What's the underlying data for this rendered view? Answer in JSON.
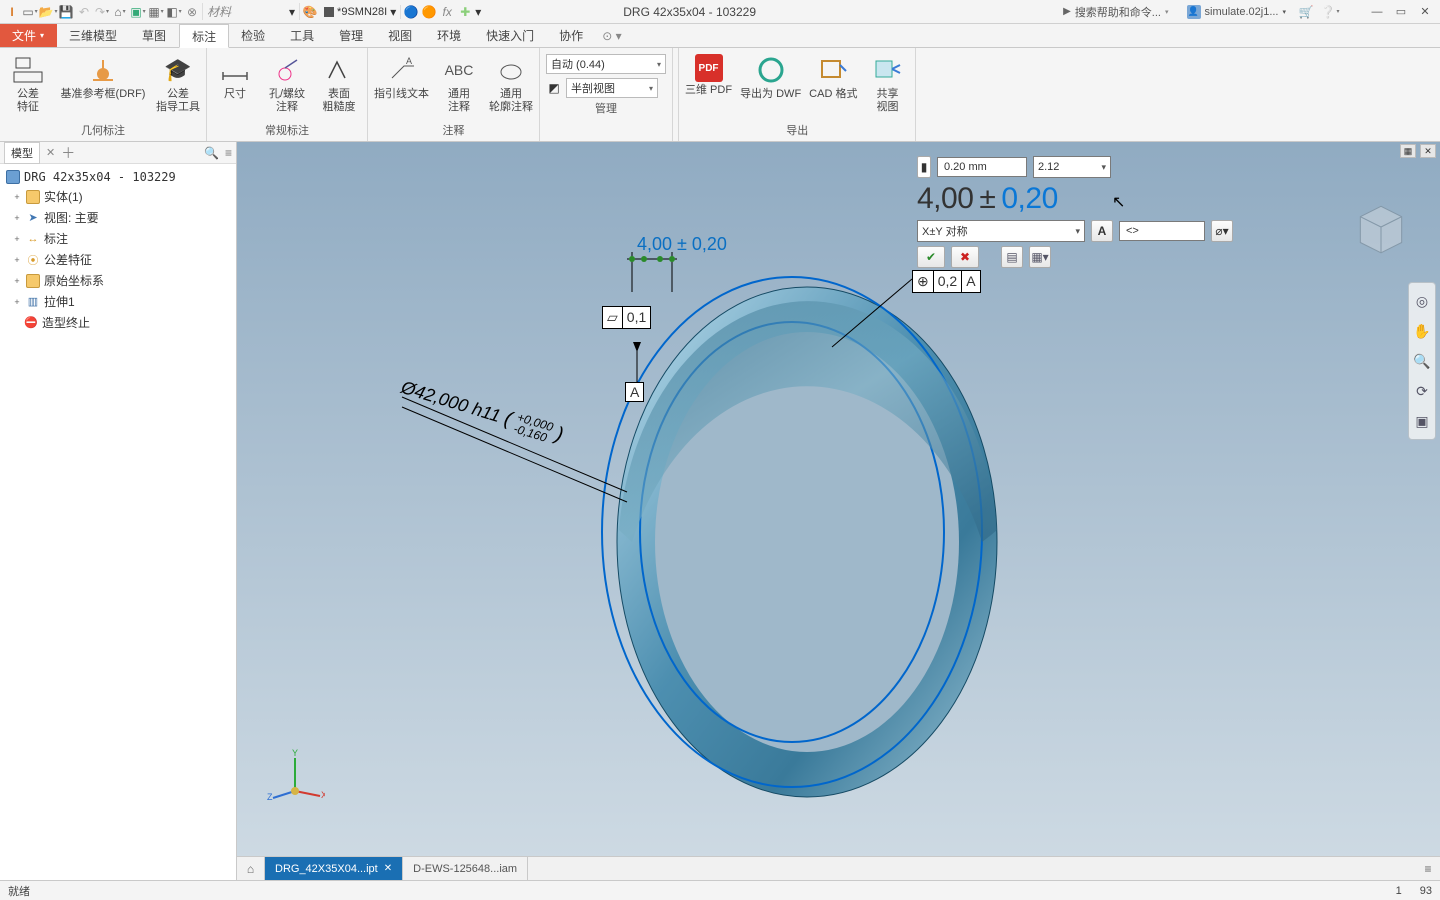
{
  "title_document": "DRG 42x35x04  -  103229",
  "material_label": "材料",
  "material_value": "*9SMN28I",
  "search_placeholder": "搜索帮助和命令...",
  "user_name": "simulate.02j1...",
  "tabs": {
    "file": "文件",
    "t3d": "三维模型",
    "sketch": "草图",
    "annotate": "标注",
    "inspect": "检验",
    "tools": "工具",
    "manage": "管理",
    "view": "视图",
    "env": "环境",
    "getstarted": "快速入门",
    "collab": "协作"
  },
  "ribbon": {
    "group_geo": "几何标注",
    "group_note": "常规标注",
    "group_ann": "注释",
    "group_mgmt": "管理",
    "group_export": "导出",
    "btn_tol_feature": "公差\n特征",
    "btn_datum": "基准参考框(DRF)",
    "btn_tol_guide": "公差\n指导工具",
    "btn_dim": "尺寸",
    "btn_hole": "孔/螺纹\n注释",
    "btn_surface": "表面\n粗糙度",
    "btn_leader": "指引线文本",
    "btn_gennote": "通用\n注释",
    "btn_profnote": "通用\n轮廓注释",
    "auto_combo": "自动 (0.44)",
    "section_combo": "半剖视图",
    "btn_3dpdf": "三维 PDF",
    "btn_dwf": "导出为 DWF",
    "btn_cad": "CAD 格式",
    "btn_share": "共享\n视图"
  },
  "browser": {
    "panel_tab": "模型",
    "root": "DRG 42x35x04  -  103229",
    "n_solid": "实体(1)",
    "n_view": "视图: 主要",
    "n_annotation": "标注",
    "n_tolfeat": "公差特征",
    "n_origin": "原始坐标系",
    "n_extrude": "拉伸1",
    "n_end": "造型终止"
  },
  "dimedit": {
    "value_field": "0.20 mm",
    "prec_select": "2.12",
    "nominal": "4,00",
    "plusminus": "±",
    "tolerance": "0,20",
    "type_select": "X±Y  对称",
    "text_field": "<>",
    "canvas_dim": "4,00 ± 0,20",
    "diameter_label": "Ø42,000 h11",
    "diam_uptol": "+0,000",
    "diam_lotol": "-0,160",
    "flat_val": "0,1",
    "datum_A": "A",
    "posn_val": "0,2",
    "posn_ref": "A"
  },
  "doctabs": {
    "active": "DRG_42X35X04...ipt",
    "other": "D-EWS-125648...iam"
  },
  "status": {
    "ready": "就绪",
    "num1": "1",
    "num2": "93"
  }
}
